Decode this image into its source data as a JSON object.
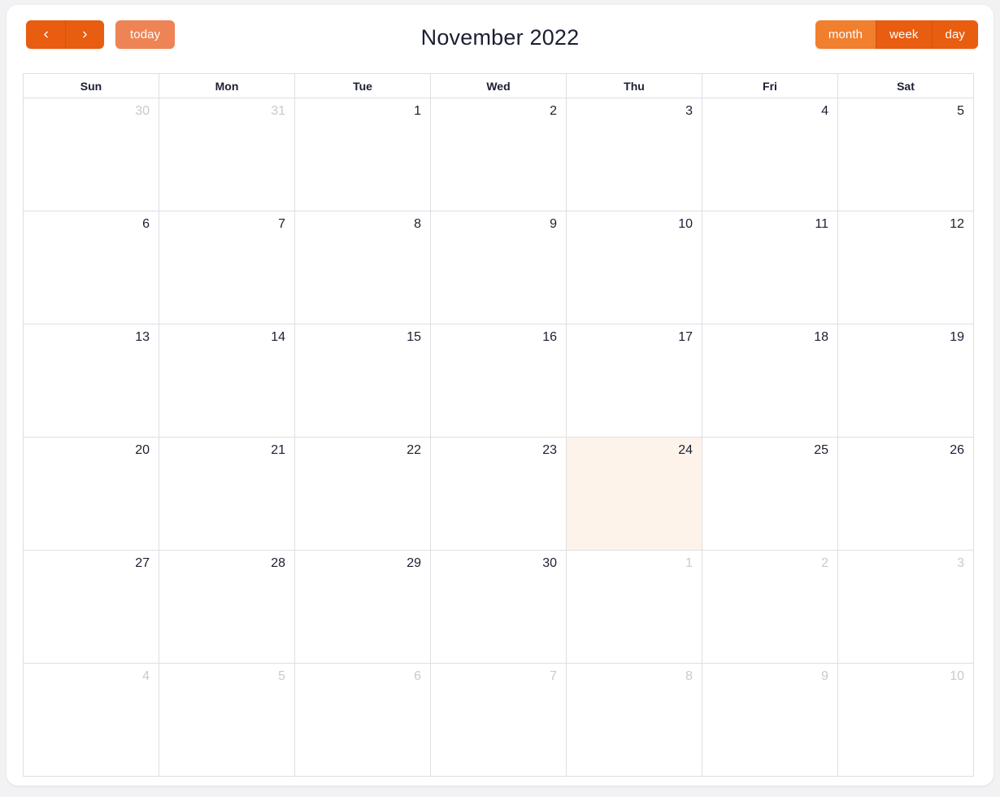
{
  "toolbar": {
    "prev_label": "prev",
    "next_label": "next",
    "prev_icon": "chevron-left-icon",
    "next_icon": "chevron-right-icon",
    "today_label": "today",
    "title": "November 2022",
    "views": [
      {
        "label": "month",
        "active": true
      },
      {
        "label": "week",
        "active": false
      },
      {
        "label": "day",
        "active": false
      }
    ]
  },
  "colors": {
    "accent": "#e85d10",
    "accent_active": "#f07f2e",
    "accent_muted": "#ee8455",
    "today_cell": "#fdf3eb",
    "text": "#1b1f33",
    "text_muted": "#c9c9cf",
    "border": "#dfdfe3",
    "page_bg": "#f2f2f4",
    "card_bg": "#ffffff"
  },
  "calendar": {
    "month": "November",
    "year": "2022",
    "weekday_headers": [
      "Sun",
      "Mon",
      "Tue",
      "Wed",
      "Thu",
      "Fri",
      "Sat"
    ],
    "weeks": [
      [
        {
          "num": "30",
          "other_month": true,
          "today": false
        },
        {
          "num": "31",
          "other_month": true,
          "today": false
        },
        {
          "num": "1",
          "other_month": false,
          "today": false
        },
        {
          "num": "2",
          "other_month": false,
          "today": false
        },
        {
          "num": "3",
          "other_month": false,
          "today": false
        },
        {
          "num": "4",
          "other_month": false,
          "today": false
        },
        {
          "num": "5",
          "other_month": false,
          "today": false
        }
      ],
      [
        {
          "num": "6",
          "other_month": false,
          "today": false
        },
        {
          "num": "7",
          "other_month": false,
          "today": false
        },
        {
          "num": "8",
          "other_month": false,
          "today": false
        },
        {
          "num": "9",
          "other_month": false,
          "today": false
        },
        {
          "num": "10",
          "other_month": false,
          "today": false
        },
        {
          "num": "11",
          "other_month": false,
          "today": false
        },
        {
          "num": "12",
          "other_month": false,
          "today": false
        }
      ],
      [
        {
          "num": "13",
          "other_month": false,
          "today": false
        },
        {
          "num": "14",
          "other_month": false,
          "today": false
        },
        {
          "num": "15",
          "other_month": false,
          "today": false
        },
        {
          "num": "16",
          "other_month": false,
          "today": false
        },
        {
          "num": "17",
          "other_month": false,
          "today": false
        },
        {
          "num": "18",
          "other_month": false,
          "today": false
        },
        {
          "num": "19",
          "other_month": false,
          "today": false
        }
      ],
      [
        {
          "num": "20",
          "other_month": false,
          "today": false
        },
        {
          "num": "21",
          "other_month": false,
          "today": false
        },
        {
          "num": "22",
          "other_month": false,
          "today": false
        },
        {
          "num": "23",
          "other_month": false,
          "today": false
        },
        {
          "num": "24",
          "other_month": false,
          "today": true
        },
        {
          "num": "25",
          "other_month": false,
          "today": false
        },
        {
          "num": "26",
          "other_month": false,
          "today": false
        }
      ],
      [
        {
          "num": "27",
          "other_month": false,
          "today": false
        },
        {
          "num": "28",
          "other_month": false,
          "today": false
        },
        {
          "num": "29",
          "other_month": false,
          "today": false
        },
        {
          "num": "30",
          "other_month": false,
          "today": false
        },
        {
          "num": "1",
          "other_month": true,
          "today": false
        },
        {
          "num": "2",
          "other_month": true,
          "today": false
        },
        {
          "num": "3",
          "other_month": true,
          "today": false
        }
      ],
      [
        {
          "num": "4",
          "other_month": true,
          "today": false
        },
        {
          "num": "5",
          "other_month": true,
          "today": false
        },
        {
          "num": "6",
          "other_month": true,
          "today": false
        },
        {
          "num": "7",
          "other_month": true,
          "today": false
        },
        {
          "num": "8",
          "other_month": true,
          "today": false
        },
        {
          "num": "9",
          "other_month": true,
          "today": false
        },
        {
          "num": "10",
          "other_month": true,
          "today": false
        }
      ]
    ]
  }
}
